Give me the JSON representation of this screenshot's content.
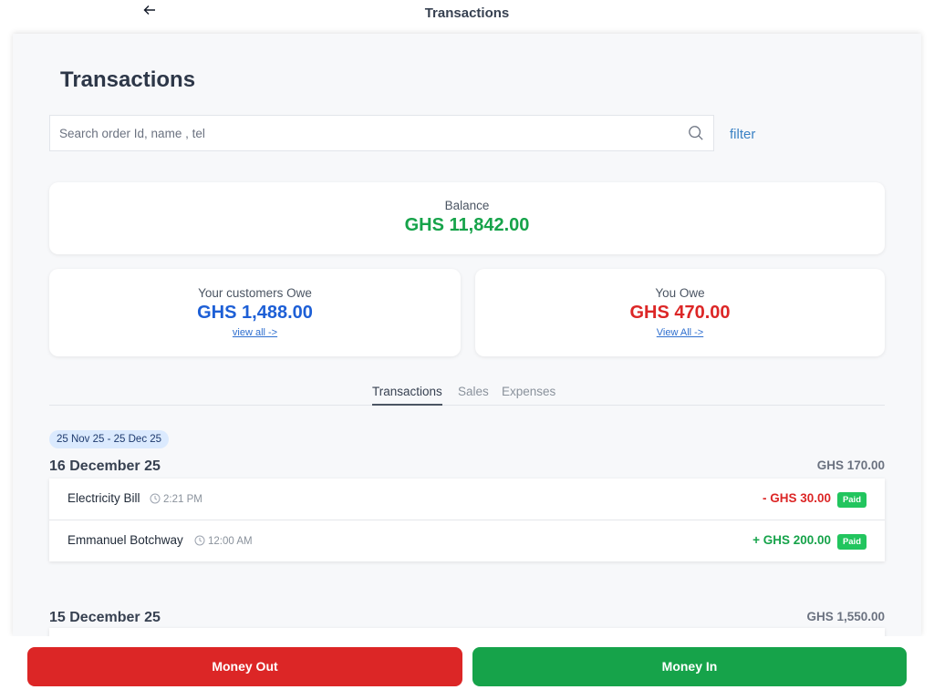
{
  "topbar": {
    "back_icon": "arrow-left-icon",
    "title": "Transactions"
  },
  "page": {
    "title": "Transactions"
  },
  "search": {
    "placeholder": "Search order Id, name , tel",
    "value": "",
    "icon": "search-icon",
    "filter_label": "filter"
  },
  "balance": {
    "label": "Balance",
    "amount": "GHS 11,842.00",
    "color": "#16a34a"
  },
  "customers_owe": {
    "label": "Your customers Owe",
    "amount": "GHS 1,488.00",
    "link": "view all ->",
    "color": "#1d5fd6"
  },
  "you_owe": {
    "label": "You Owe",
    "amount": "GHS 470.00",
    "link": "View All ->",
    "color": "#dc2626"
  },
  "tabs": [
    {
      "label": "Transactions",
      "active": true
    },
    {
      "label": "Sales",
      "active": false
    },
    {
      "label": "Expenses",
      "active": false
    }
  ],
  "date_range": "25 Nov 25 - 25 Dec 25",
  "days": [
    {
      "date": "16 December 25",
      "total": "GHS 170.00",
      "transactions": [
        {
          "name": "Electricity Bill",
          "time": "2:21 PM",
          "amount": "- GHS 30.00",
          "type": "out",
          "status": "Paid"
        },
        {
          "name": "Emmanuel Botchway",
          "time": "12:00 AM",
          "amount": "+ GHS 200.00",
          "type": "in",
          "status": "Paid"
        }
      ]
    },
    {
      "date": "15 December 25",
      "total": "GHS 1,550.00",
      "transactions": []
    }
  ],
  "actions": {
    "money_out": "Money Out",
    "money_in": "Money In",
    "out_color": "#dc2626",
    "in_color": "#16a34a"
  }
}
